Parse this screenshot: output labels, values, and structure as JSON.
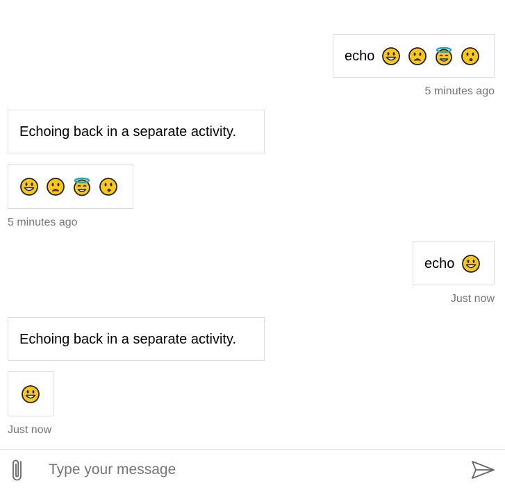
{
  "colors": {
    "bubble_border": "#dcdcdc",
    "timestamp": "#767676",
    "emoji_face": "#f8c61c",
    "halo": "#2aa3b3"
  },
  "messages": [
    {
      "from": "user",
      "text": "echo",
      "emojis": [
        "grinning-face-icon",
        "frowning-face-icon",
        "halo-face-icon",
        "hushed-face-icon"
      ],
      "timestamp": "5 minutes ago"
    },
    {
      "from": "bot",
      "text": "Echoing back in a separate activity."
    },
    {
      "from": "bot",
      "emojis": [
        "grinning-face-icon",
        "frowning-face-icon",
        "halo-face-icon",
        "hushed-face-icon"
      ],
      "timestamp": "5 minutes ago"
    },
    {
      "from": "user",
      "text": "echo",
      "emojis": [
        "grinning-face-icon"
      ],
      "timestamp": "Just now"
    },
    {
      "from": "bot",
      "text": "Echoing back in a separate activity."
    },
    {
      "from": "bot",
      "emojis": [
        "grinning-face-icon"
      ],
      "timestamp": "Just now"
    }
  ],
  "sendbox": {
    "placeholder": "Type your message",
    "value": "",
    "attach_icon": "paperclip-icon",
    "send_icon": "send-icon"
  }
}
